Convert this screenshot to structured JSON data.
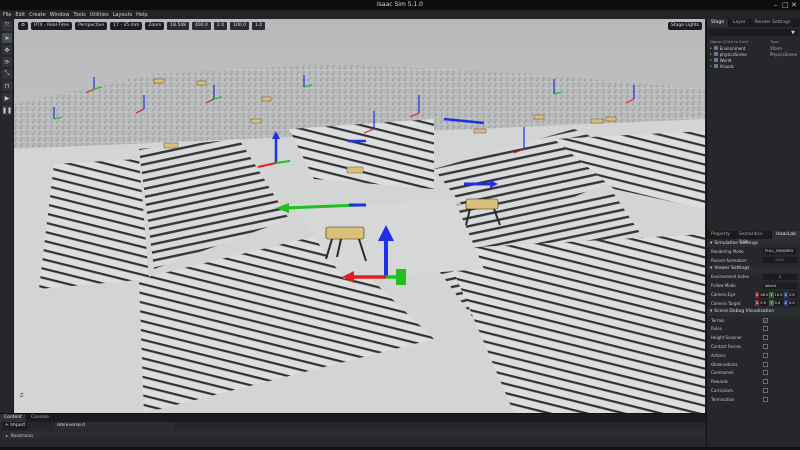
{
  "window": {
    "title": "Isaac Sim 5.1.0",
    "minimize": "–",
    "maximize": "□",
    "close": "✕"
  },
  "menu": [
    "File",
    "Edit",
    "Create",
    "Window",
    "Tools",
    "Utilities",
    "Layouts",
    "Help"
  ],
  "left_tools": [
    {
      "name": "select-icon",
      "glyph": "⤧"
    },
    {
      "name": "pointer-icon",
      "glyph": "➤"
    },
    {
      "name": "move-icon",
      "glyph": "✥"
    },
    {
      "name": "rotate-icon",
      "glyph": "⟳"
    },
    {
      "name": "scale-icon",
      "glyph": "⤡"
    },
    {
      "name": "snap-icon",
      "glyph": "⊓"
    },
    {
      "name": "play-icon",
      "glyph": "▶"
    },
    {
      "name": "pause-icon",
      "glyph": "❚❚"
    }
  ],
  "viewport": {
    "settings_btn": "⚙",
    "render_mode": "RTX - Real-Time",
    "camera": "Perspective",
    "lens": "17 - 35 mm",
    "zoom_label": "Zoom",
    "zoom_value": "18.548",
    "field2": "400.0",
    "field3": "2.0",
    "field4": "100.0",
    "field5": "1.0",
    "stage_lights": "Stage Lights",
    "axis_label": "Z"
  },
  "stage": {
    "tabs": [
      "Stage",
      "Layer",
      "Render Settings"
    ],
    "filter_icon": "▼",
    "columns": [
      "Name (Click to Sort)",
      "Type"
    ],
    "items": [
      {
        "name": "Environment",
        "type": "Xform"
      },
      {
        "name": "physicsScene",
        "type": "PhysicsScene"
      },
      {
        "name": "World",
        "type": ""
      },
      {
        "name": "Visuals",
        "type": ""
      }
    ]
  },
  "properties": {
    "tabs": [
      "Property",
      "Semantics Edit...",
      "IsaacLab"
    ],
    "sim_settings": "Simulation Settings",
    "rendering_mode_label": "Rendering Mode",
    "rendering_mode_value": "FULL_RENDERI",
    "record_animation_label": "Record Animation",
    "record_animation_value": "Start",
    "viewer_settings": "Viewer Settings",
    "env_index_label": "Environment Index",
    "env_index_value": "1",
    "follow_mode_label": "Follow Mode",
    "follow_mode_value": "World",
    "camera_eye_label": "Camera Eye",
    "camera_eye": [
      "48.5",
      "10.5",
      "2.6"
    ],
    "camera_target_label": "Camera Target",
    "camera_target": [
      "0.0",
      "0.0",
      "0.0"
    ],
    "debug_section": "Scene Debug Visualization",
    "debug_items": [
      {
        "label": "Terrain",
        "checked": "✓"
      },
      {
        "label": "Rules",
        "checked": ""
      },
      {
        "label": "Height Scanner",
        "checked": ""
      },
      {
        "label": "Contact Forces",
        "checked": ""
      },
      {
        "label": "Actions",
        "checked": ""
      },
      {
        "label": "Observations",
        "checked": ""
      },
      {
        "label": "Commands",
        "checked": ""
      },
      {
        "label": "Rewards",
        "checked": ""
      },
      {
        "label": "Curriculum",
        "checked": ""
      },
      {
        "label": "Termination",
        "checked": ""
      }
    ]
  },
  "bottom": {
    "tabs": [
      "Content",
      "Console"
    ],
    "import_btn": "+ Import",
    "path": "omniverse://",
    "bookmarks": "Bookmarks"
  },
  "colors": {
    "x_axis": "#e02020",
    "y_axis": "#20c020",
    "z_axis": "#1f2fe6",
    "robot": "#d9c07a"
  }
}
